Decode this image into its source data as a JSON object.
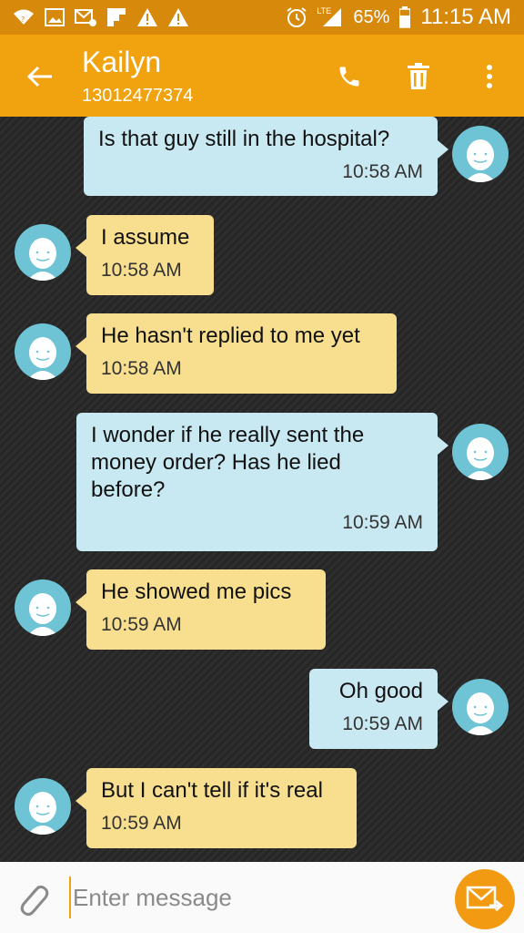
{
  "status_bar": {
    "battery": "65%",
    "time": "11:15 AM",
    "network": "LTE",
    "left_icons": [
      "wifi-icon",
      "image-icon",
      "mail-icon",
      "flipboard-icon",
      "warning-icon",
      "warning-icon"
    ],
    "right_icons": [
      "alarm-icon",
      "signal-icon",
      "battery-icon"
    ]
  },
  "header": {
    "contact_name": "Kailyn",
    "contact_number": "13012477374",
    "actions": [
      "back-arrow-icon",
      "phone-icon",
      "trash-icon",
      "more-vert-icon"
    ]
  },
  "messages": [
    {
      "direction": "out",
      "text": "Is that guy still in the hospital?",
      "time": "10:58 AM"
    },
    {
      "direction": "in",
      "text": "I assume",
      "time": "10:58 AM"
    },
    {
      "direction": "in",
      "text": "He hasn't replied to me yet",
      "time": "10:58 AM"
    },
    {
      "direction": "out",
      "text": "I wonder if he really sent the money order? Has he lied before?",
      "time": "10:59 AM"
    },
    {
      "direction": "in",
      "text": "He showed me pics",
      "time": "10:59 AM"
    },
    {
      "direction": "out",
      "text": "Oh good",
      "time": "10:59 AM"
    },
    {
      "direction": "in",
      "text": "But I can't tell if it's real",
      "time": "10:59 AM"
    }
  ],
  "composer": {
    "placeholder": "Enter message"
  },
  "colors": {
    "status_bar": "#d7890b",
    "app_bar": "#f0a20f",
    "outgoing_bubble": "#c9e9f2",
    "incoming_bubble": "#f7df8f",
    "avatar": "#6ec3d4",
    "send_button": "#f29a12"
  }
}
